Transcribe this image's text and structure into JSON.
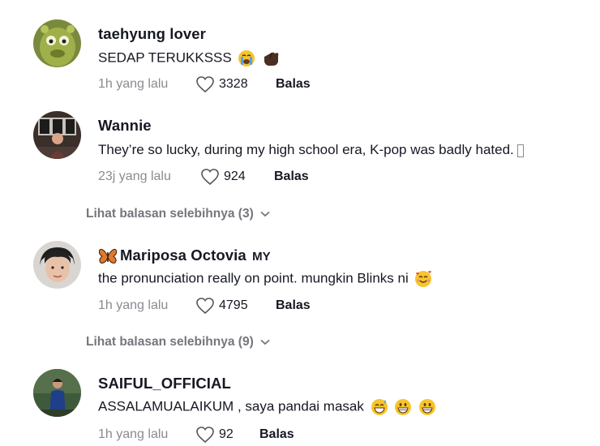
{
  "comments": [
    {
      "username": "taehyung lover",
      "text": "SEDAP TERUKKSSS",
      "emojis": [
        "crying-face-emoji",
        "hand-emoji"
      ],
      "time": "1h yang lalu",
      "likes": "3328",
      "reply_label": "Balas"
    },
    {
      "username": "Wannie",
      "text": "They’re so lucky, during my high school era, K-pop was badly hated.",
      "emojis": [
        "unrendered-glyph"
      ],
      "time": "23j yang lalu",
      "likes": "924",
      "reply_label": "Balas",
      "more_replies": "Lihat balasan selebihnya (3)"
    },
    {
      "username": "Mariposa Octovia",
      "username_prefix_emoji": "butterfly-emoji",
      "country": "MY",
      "text": "the pronunciation really on point. mungkin Blinks ni",
      "emojis": [
        "smiling-face-with-hearts-emoji"
      ],
      "time": "1h yang lalu",
      "likes": "4795",
      "reply_label": "Balas",
      "more_replies": "Lihat balasan selebihnya (9)"
    },
    {
      "username": "SAIFUL_OFFICIAL",
      "text": "ASSALAMUALAIKUM , saya pandai masak",
      "emojis": [
        "grinning-sweat-emoji",
        "grinning-face-emoji",
        "grinning-face-emoji"
      ],
      "time": "1h yang lalu",
      "likes": "92",
      "reply_label": "Balas"
    }
  ]
}
